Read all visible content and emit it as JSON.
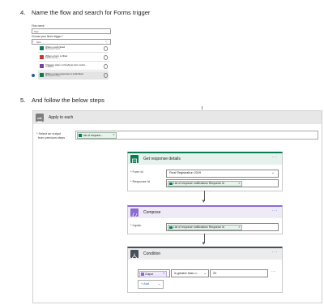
{
  "step4": {
    "number": "4.",
    "text": "Name the flow and search for Forms trigger"
  },
  "mini": {
    "flow_name_label": "Flow name",
    "flow_name_value": "Test",
    "choose_trigger_label": "Choose your flow's trigger *",
    "search_value": "form",
    "triggers": [
      {
        "title": "When a submitted",
        "subtitle": "Microsoft Forms"
      },
      {
        "title": "When a form is filled",
        "subtitle": "Adobe Forms"
      },
      {
        "title": "Triggers when a OneNote form subm...",
        "subtitle": "OneNote"
      },
      {
        "title": "When a new response is submitted",
        "subtitle": "Microsoft Forms"
      }
    ]
  },
  "step5": {
    "number": "5.",
    "text": "And follow the below steps"
  },
  "apply_each": {
    "title": "Apply to each",
    "select_label_1": "* Select an output",
    "select_label_2": "from previous steps",
    "token": "List of respons...",
    "token_x": "×"
  },
  "get_response": {
    "title": "Get response details",
    "menu": "···",
    "form_id_label": "* Form Id",
    "form_id_value": "Final Registration 2019",
    "response_id_label": "* Response Id",
    "token": "List of response notifications Response Id",
    "token_x": "×"
  },
  "compose": {
    "title": "Compose",
    "menu": "···",
    "inputs_label": "* Inputs",
    "token": "List of response notifications Response Id",
    "token_x": "×"
  },
  "condition": {
    "title": "Condition",
    "menu": "···",
    "operand_token": "Output",
    "operand_x": "×",
    "operator": "is greater than o...",
    "value": "20",
    "add_label": "+ Add",
    "add_chevron": "⌄",
    "row_menu": "···"
  },
  "colors": {
    "apply_each_header": "#e7e7e7",
    "forms_green": "#0b7a52",
    "compose_purple": "#8c6cd0",
    "condition_dark": "#484f58"
  }
}
